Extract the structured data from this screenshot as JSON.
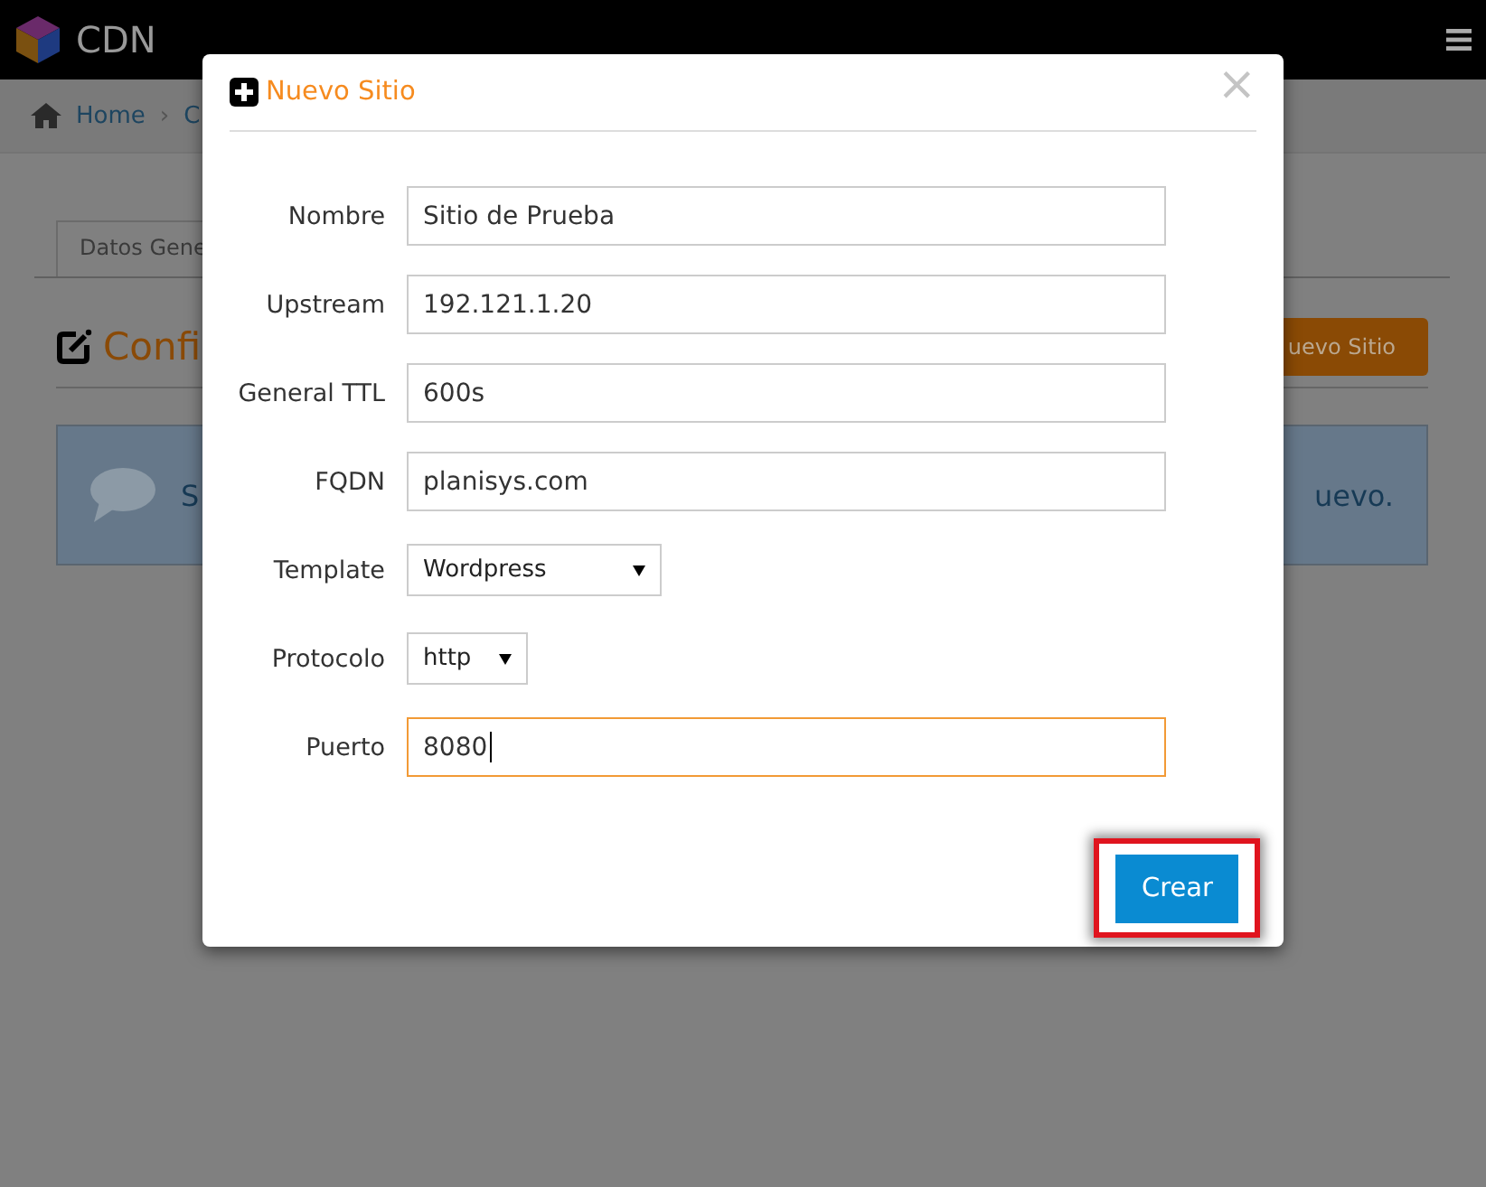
{
  "topbar": {
    "brand": "CDN"
  },
  "breadcrumb": {
    "items": [
      "Home",
      "C"
    ],
    "separator": "›"
  },
  "page": {
    "tab": "Datos Gene",
    "title": "Confi",
    "new_button": "uevo Sitio",
    "alert_start": "S",
    "alert_end": "uevo."
  },
  "modal": {
    "title": "Nuevo Sitio",
    "close": "×",
    "fields": [
      {
        "kind": "text",
        "label": "Nombre",
        "value": "Sitio de Prueba",
        "focused": false
      },
      {
        "kind": "text",
        "label": "Upstream",
        "value": "192.121.1.20",
        "focused": false
      },
      {
        "kind": "text",
        "label": "General TTL",
        "value": "600s",
        "focused": false
      },
      {
        "kind": "text",
        "label": "FQDN",
        "value": "planisys.com",
        "focused": false
      },
      {
        "kind": "select",
        "label": "Template",
        "value": "Wordpress",
        "focused": false
      },
      {
        "kind": "select",
        "label": "Protocolo",
        "value": "http",
        "focused": false
      },
      {
        "kind": "text",
        "label": "Puerto",
        "value": "8080",
        "focused": true
      }
    ],
    "submit": {
      "label": "Crear",
      "highlighted": true
    }
  }
}
